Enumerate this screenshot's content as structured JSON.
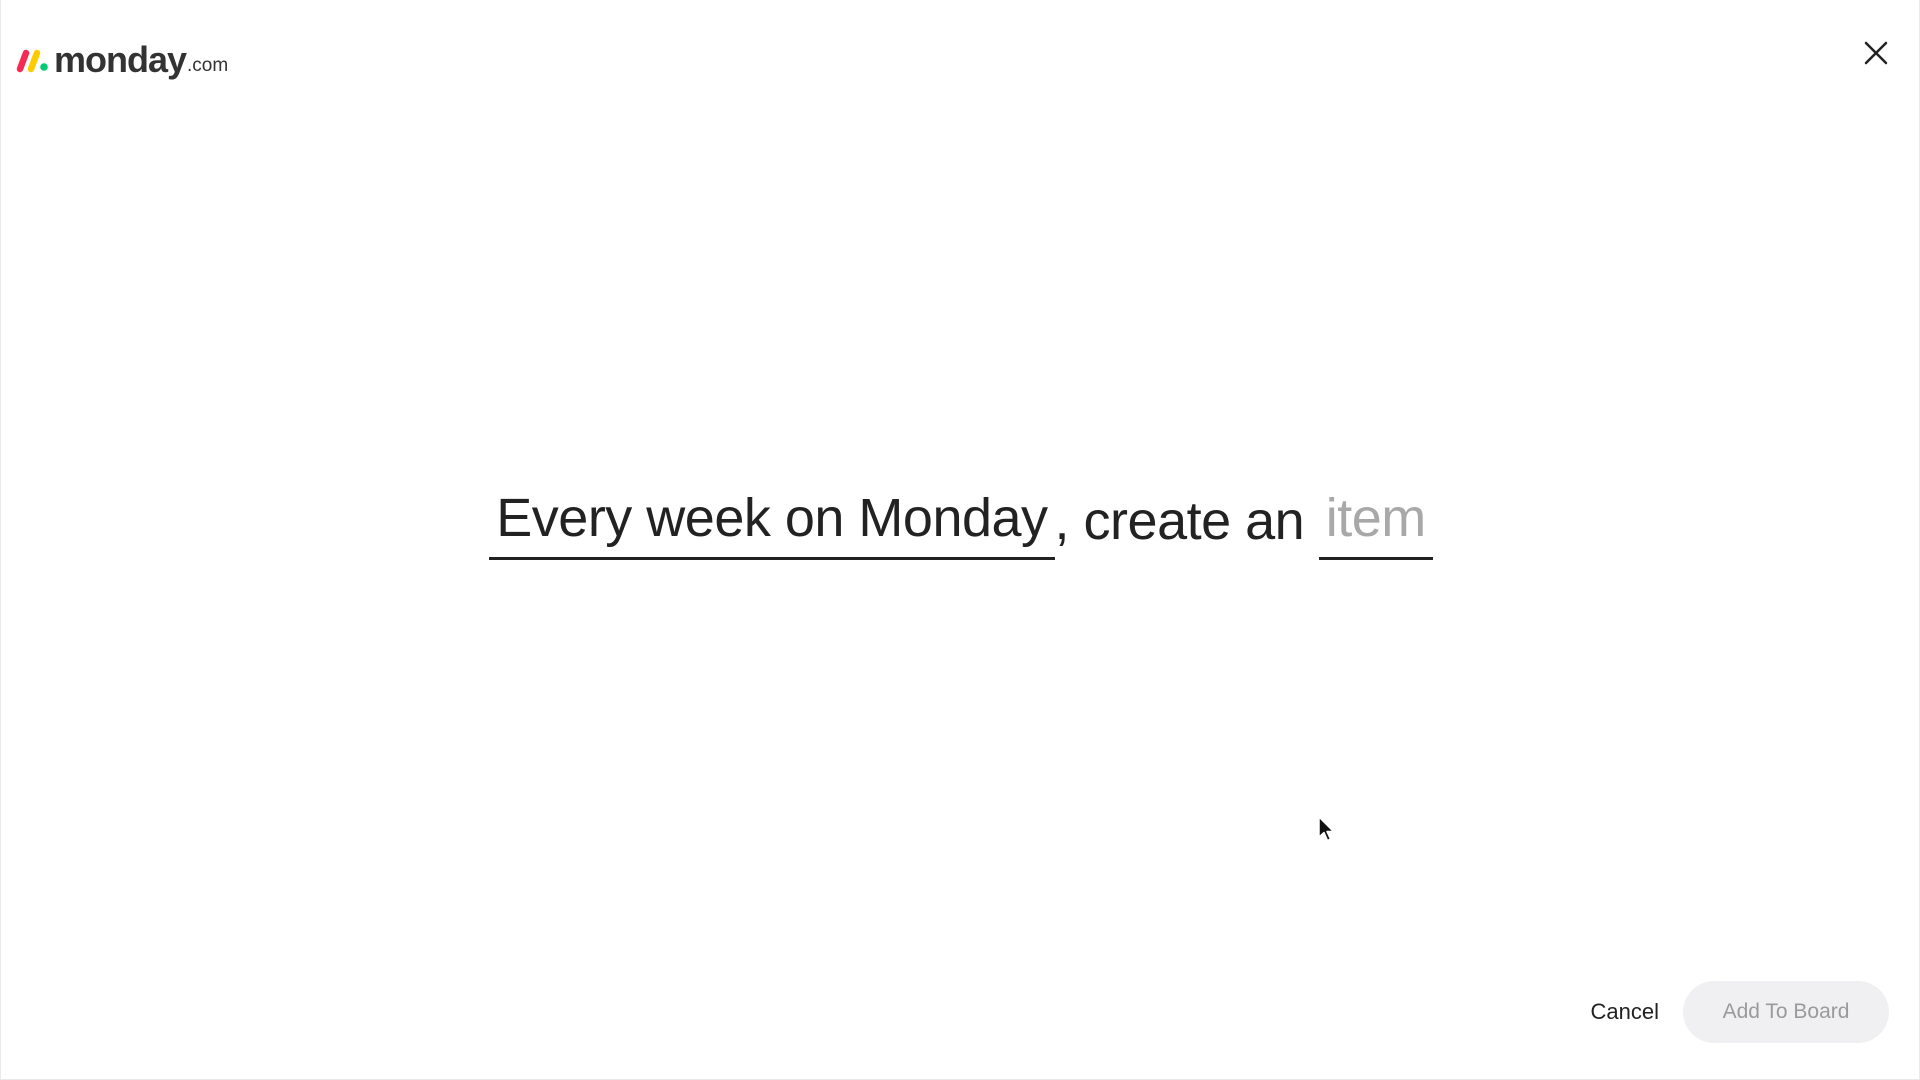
{
  "header": {
    "logo_word": "monday",
    "logo_suffix": ".com",
    "logo_colors": [
      "#f62b54",
      "#ffcc00",
      "#00ca72"
    ]
  },
  "recipe": {
    "part1": "Every week on Monday",
    "part2": ", create an ",
    "part3_placeholder": "item"
  },
  "footer": {
    "cancel_label": "Cancel",
    "add_label": "Add To Board"
  }
}
